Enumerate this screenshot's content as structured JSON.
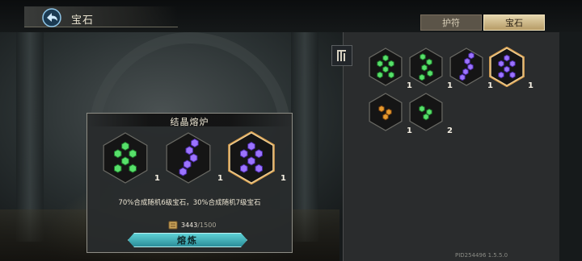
{
  "header": {
    "title": "宝石",
    "back_icon": "back-arrow-icon"
  },
  "tabs": [
    {
      "label": "护符",
      "active": false
    },
    {
      "label": "宝石",
      "active": true
    }
  ],
  "colors": {
    "green_gem": "#3fbf4a",
    "purple_gem": "#7b4fd6",
    "orange_gem": "#c6781c",
    "selected_border": "#d9a050",
    "button_teal": "#2fa3ad"
  },
  "inventory": {
    "sort_icon": "sort-icon",
    "items": [
      {
        "gem_color": "green",
        "shape": "cluster",
        "count": "1",
        "selected": false
      },
      {
        "gem_color": "green",
        "shape": "column",
        "count": "1",
        "selected": false
      },
      {
        "gem_color": "purple",
        "shape": "diagonal",
        "count": "1",
        "selected": false
      },
      {
        "gem_color": "purple",
        "shape": "cluster",
        "count": "1",
        "selected": true
      },
      {
        "gem_color": "orange",
        "shape": "pair",
        "count": "1",
        "selected": false
      },
      {
        "gem_color": "green",
        "shape": "pair",
        "count": "2",
        "selected": false
      }
    ],
    "version": "PID254496 1.5.5.0"
  },
  "crafting": {
    "title": "结晶熔炉",
    "slots": [
      {
        "gem_color": "green",
        "shape": "cluster",
        "count": "1",
        "selected": false
      },
      {
        "gem_color": "purple",
        "shape": "diagonal",
        "count": "1",
        "selected": false
      },
      {
        "gem_color": "purple",
        "shape": "cluster",
        "count": "1",
        "selected": true
      }
    ],
    "description": "70%合成随机6级宝石，30%合成随机7级宝石",
    "cost": {
      "have": "3443",
      "need": "/1500",
      "icon": "scroll-icon"
    },
    "button_label": "熔炼"
  }
}
